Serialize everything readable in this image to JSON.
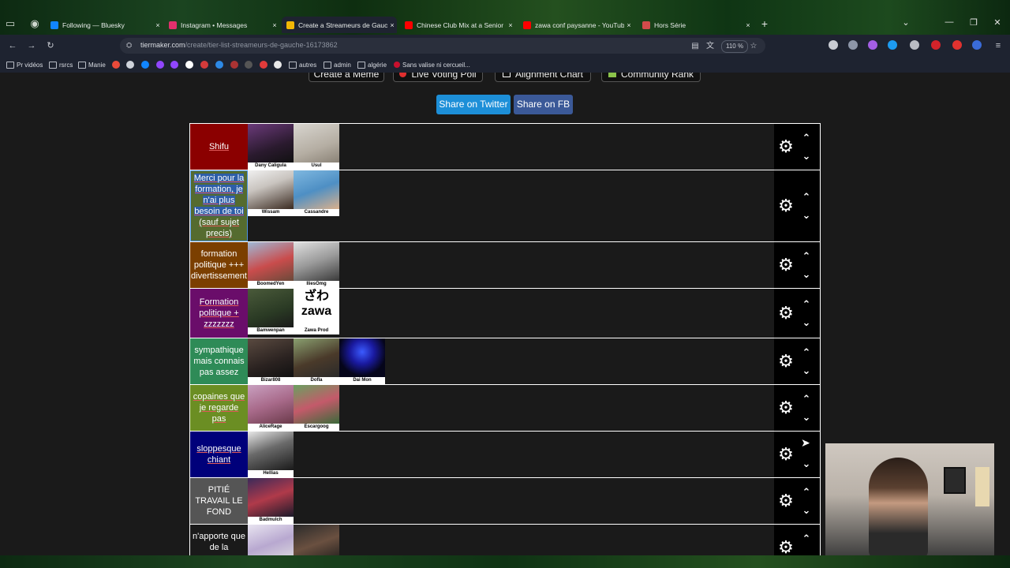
{
  "browser": {
    "tabs": [
      {
        "label": "Following — Bluesky",
        "close": "×",
        "color": "#1185fe",
        "active": false
      },
      {
        "label": "Instagram • Messages",
        "close": "×",
        "color": "#e1306c",
        "active": false
      },
      {
        "label": "Create a Streameurs de Gauche",
        "close": "×",
        "color": "#f2b705",
        "active": true
      },
      {
        "label": "Chinese Club Mix at a Senior Ce",
        "close": "×",
        "color": "#ff0000",
        "active": false
      },
      {
        "label": "zawa conf paysanne - YouTube",
        "close": "×",
        "color": "#ff0000",
        "active": false
      },
      {
        "label": "Hors Série",
        "close": "×",
        "color": "#d24b4b",
        "active": false
      }
    ],
    "new_tab": "+",
    "window_controls": {
      "minimize": "—",
      "restore": "❐",
      "close": "✕",
      "tab_list": "⌄"
    },
    "url": {
      "host": "tiermaker.com",
      "path": "/create/tier-list-streameurs-de-gauche-16173862"
    },
    "zoom": "110 %",
    "bookmarks": [
      {
        "label": "Pr vidéos",
        "type": "folder"
      },
      {
        "label": "rsrcs",
        "type": "folder"
      },
      {
        "label": "Manie",
        "type": "folder"
      },
      {
        "label": "autres",
        "type": "folder"
      },
      {
        "label": "admin",
        "type": "folder"
      },
      {
        "label": "algérie",
        "type": "folder"
      },
      {
        "label": "Sans valise ni cercueil...",
        "type": "link"
      }
    ]
  },
  "page": {
    "top_buttons": [
      "Create a Meme",
      "Live Voting Poll",
      "Alignment Chart",
      "Community Rank"
    ],
    "share_twitter": "Share on Twitter",
    "share_fb": "Share on FB",
    "colors": {
      "twitter": "#1da1f2",
      "facebook": "#3b5998"
    },
    "tiers": [
      {
        "label": "Shifu",
        "color": "#8b0000",
        "items": [
          {
            "name": "Dany Caligula"
          },
          {
            "name": "Usul"
          }
        ]
      },
      {
        "label_selected": "Merci pour la formation, je n'ai plus besoin de toi",
        "label_rest": " (sauf sujet precis)",
        "color": "#556b2f",
        "items": [
          {
            "name": "Wissam"
          },
          {
            "name": "Cassandre"
          }
        ]
      },
      {
        "label": "formation politique +++ divertissement",
        "color": "#7b3f00",
        "items": [
          {
            "name": "BoomedYen"
          },
          {
            "name": "IliesOmg"
          }
        ]
      },
      {
        "label": "Formation politique + zzzzzzz",
        "color": "#6a0d6a",
        "items": [
          {
            "name": "Bamwenpan"
          },
          {
            "name": "Zawa Prod",
            "logo_text": "ざわ zawa"
          }
        ]
      },
      {
        "label": "sympathique mais connais pas assez",
        "color": "#2e8b57",
        "items": [
          {
            "name": "Bizar808"
          },
          {
            "name": "Dofla"
          },
          {
            "name": "Dai Mon"
          }
        ]
      },
      {
        "label": "copaines que je regarde pas",
        "color": "#6b8e23",
        "items": [
          {
            "name": "AliceRage"
          },
          {
            "name": "Escargoog"
          }
        ]
      },
      {
        "label": "sloppesque chiant",
        "color": "#00007a",
        "items": [
          {
            "name": "Hellias"
          }
        ]
      },
      {
        "label": "PITIÉ TRAVAIL LE FOND",
        "color": "#555555",
        "items": [
          {
            "name": "Badmulch"
          }
        ]
      },
      {
        "label": "n'apporte que de la",
        "color": "#1a1a1a",
        "items": [
          {
            "name": ""
          },
          {
            "name": ""
          }
        ]
      }
    ]
  }
}
